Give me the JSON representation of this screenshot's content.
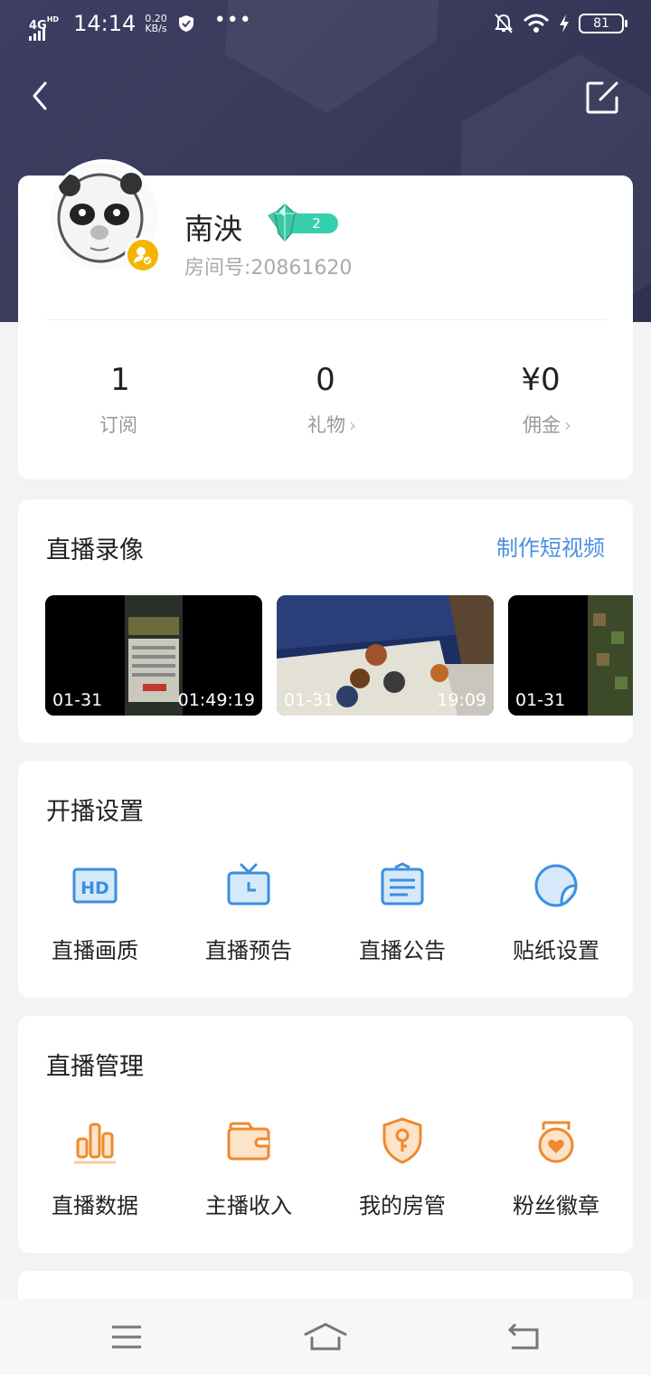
{
  "status_bar": {
    "network": "4G",
    "network_sup": "HD",
    "time": "14:14",
    "speed_value": "0.20",
    "speed_unit": "KB/s",
    "more": "•••",
    "battery": "81"
  },
  "profile": {
    "nickname": "南泱",
    "level": "2",
    "room_id": "房间号:20861620"
  },
  "stats": [
    {
      "value": "1",
      "label": "订阅",
      "chevron": ""
    },
    {
      "value": "0",
      "label": "礼物",
      "chevron": "›"
    },
    {
      "value": "¥0",
      "label": "佣金",
      "chevron": "›"
    }
  ],
  "recordings": {
    "title": "直播录像",
    "action": "制作短视频",
    "items": [
      {
        "date": "01-31",
        "duration": "01:49:19"
      },
      {
        "date": "01-31",
        "duration": "19:09"
      },
      {
        "date": "01-31",
        "duration": ""
      }
    ]
  },
  "settings": {
    "title": "开播设置",
    "items": [
      {
        "label": "直播画质",
        "icon": "hd-icon"
      },
      {
        "label": "直播预告",
        "icon": "tv-clock-icon"
      },
      {
        "label": "直播公告",
        "icon": "notice-board-icon"
      },
      {
        "label": "贴纸设置",
        "icon": "sticker-icon"
      }
    ]
  },
  "management": {
    "title": "直播管理",
    "items": [
      {
        "label": "直播数据",
        "icon": "bar-chart-icon"
      },
      {
        "label": "主播收入",
        "icon": "wallet-icon"
      },
      {
        "label": "我的房管",
        "icon": "shield-key-icon"
      },
      {
        "label": "粉丝徽章",
        "icon": "heart-badge-icon"
      }
    ]
  },
  "colors": {
    "header_bg": "#3e3d62",
    "link_blue": "#4a90e2",
    "setting_icon_blue": "#3b8fe0",
    "mgmt_icon_orange": "#ee8a2e",
    "level_teal": "#35cfb0",
    "verify_yellow": "#f5b400"
  }
}
